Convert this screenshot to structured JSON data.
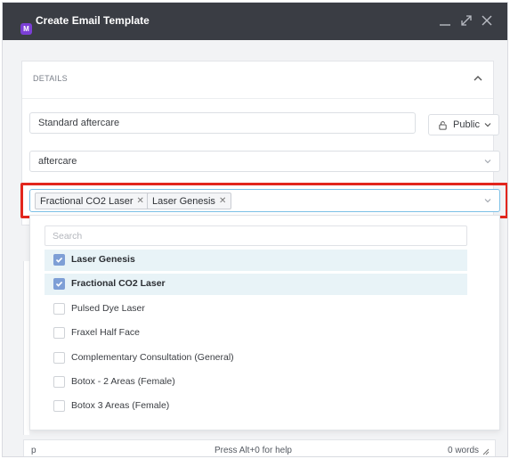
{
  "window": {
    "title": "Create Email Template",
    "logo_letter": "M",
    "accent": "#7b3fd6",
    "controls": [
      "minimize-icon",
      "maximize-icon",
      "close-icon"
    ]
  },
  "details": {
    "section_label": "DETAILS",
    "name_value": "Standard aftercare",
    "visibility_label": "Public",
    "category_value": "aftercare"
  },
  "services": {
    "selected_chips": [
      "Fractional CO2 Laser",
      "Laser Genesis"
    ],
    "search_placeholder": "Search",
    "options": [
      {
        "label": "Laser Genesis",
        "checked": true
      },
      {
        "label": "Fractional CO2 Laser",
        "checked": true
      },
      {
        "label": "Pulsed Dye Laser",
        "checked": false
      },
      {
        "label": "Fraxel Half Face",
        "checked": false
      },
      {
        "label": "Complementary Consultation (General)",
        "checked": false
      },
      {
        "label": "Botox - 2 Areas (Female)",
        "checked": false
      },
      {
        "label": "Botox 3 Areas (Female)",
        "checked": false
      }
    ]
  },
  "statusbar": {
    "path": "p",
    "help": "Press Alt+0 for help",
    "word_count": "0 words"
  },
  "colors": {
    "highlight": "#e2261d",
    "focus_border": "#7cc0e6",
    "selected_row": "#e8f3f7",
    "checkbox_checked": "#7e9fd6"
  }
}
